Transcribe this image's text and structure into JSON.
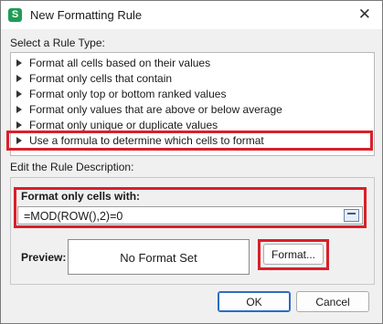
{
  "window": {
    "title": "New Formatting Rule"
  },
  "rule_type": {
    "heading": "Select a Rule Type:",
    "items": [
      "Format all cells based on their values",
      "Format only cells that contain",
      "Format only top or bottom ranked values",
      "Format only values that are above or below average",
      "Format only unique or duplicate values",
      "Use a formula to determine which cells to format"
    ],
    "selected_index": 5
  },
  "description": {
    "heading": "Edit the Rule Description:",
    "format_label": "Format only cells with:",
    "formula_value": "=MOD(ROW(),2)=0",
    "preview_label": "Preview:",
    "preview_text": "No Format Set",
    "format_button": "Format..."
  },
  "buttons": {
    "ok": "OK",
    "cancel": "Cancel"
  },
  "colors": {
    "highlight": "#d8202a",
    "app_icon": "#1f9d55"
  }
}
